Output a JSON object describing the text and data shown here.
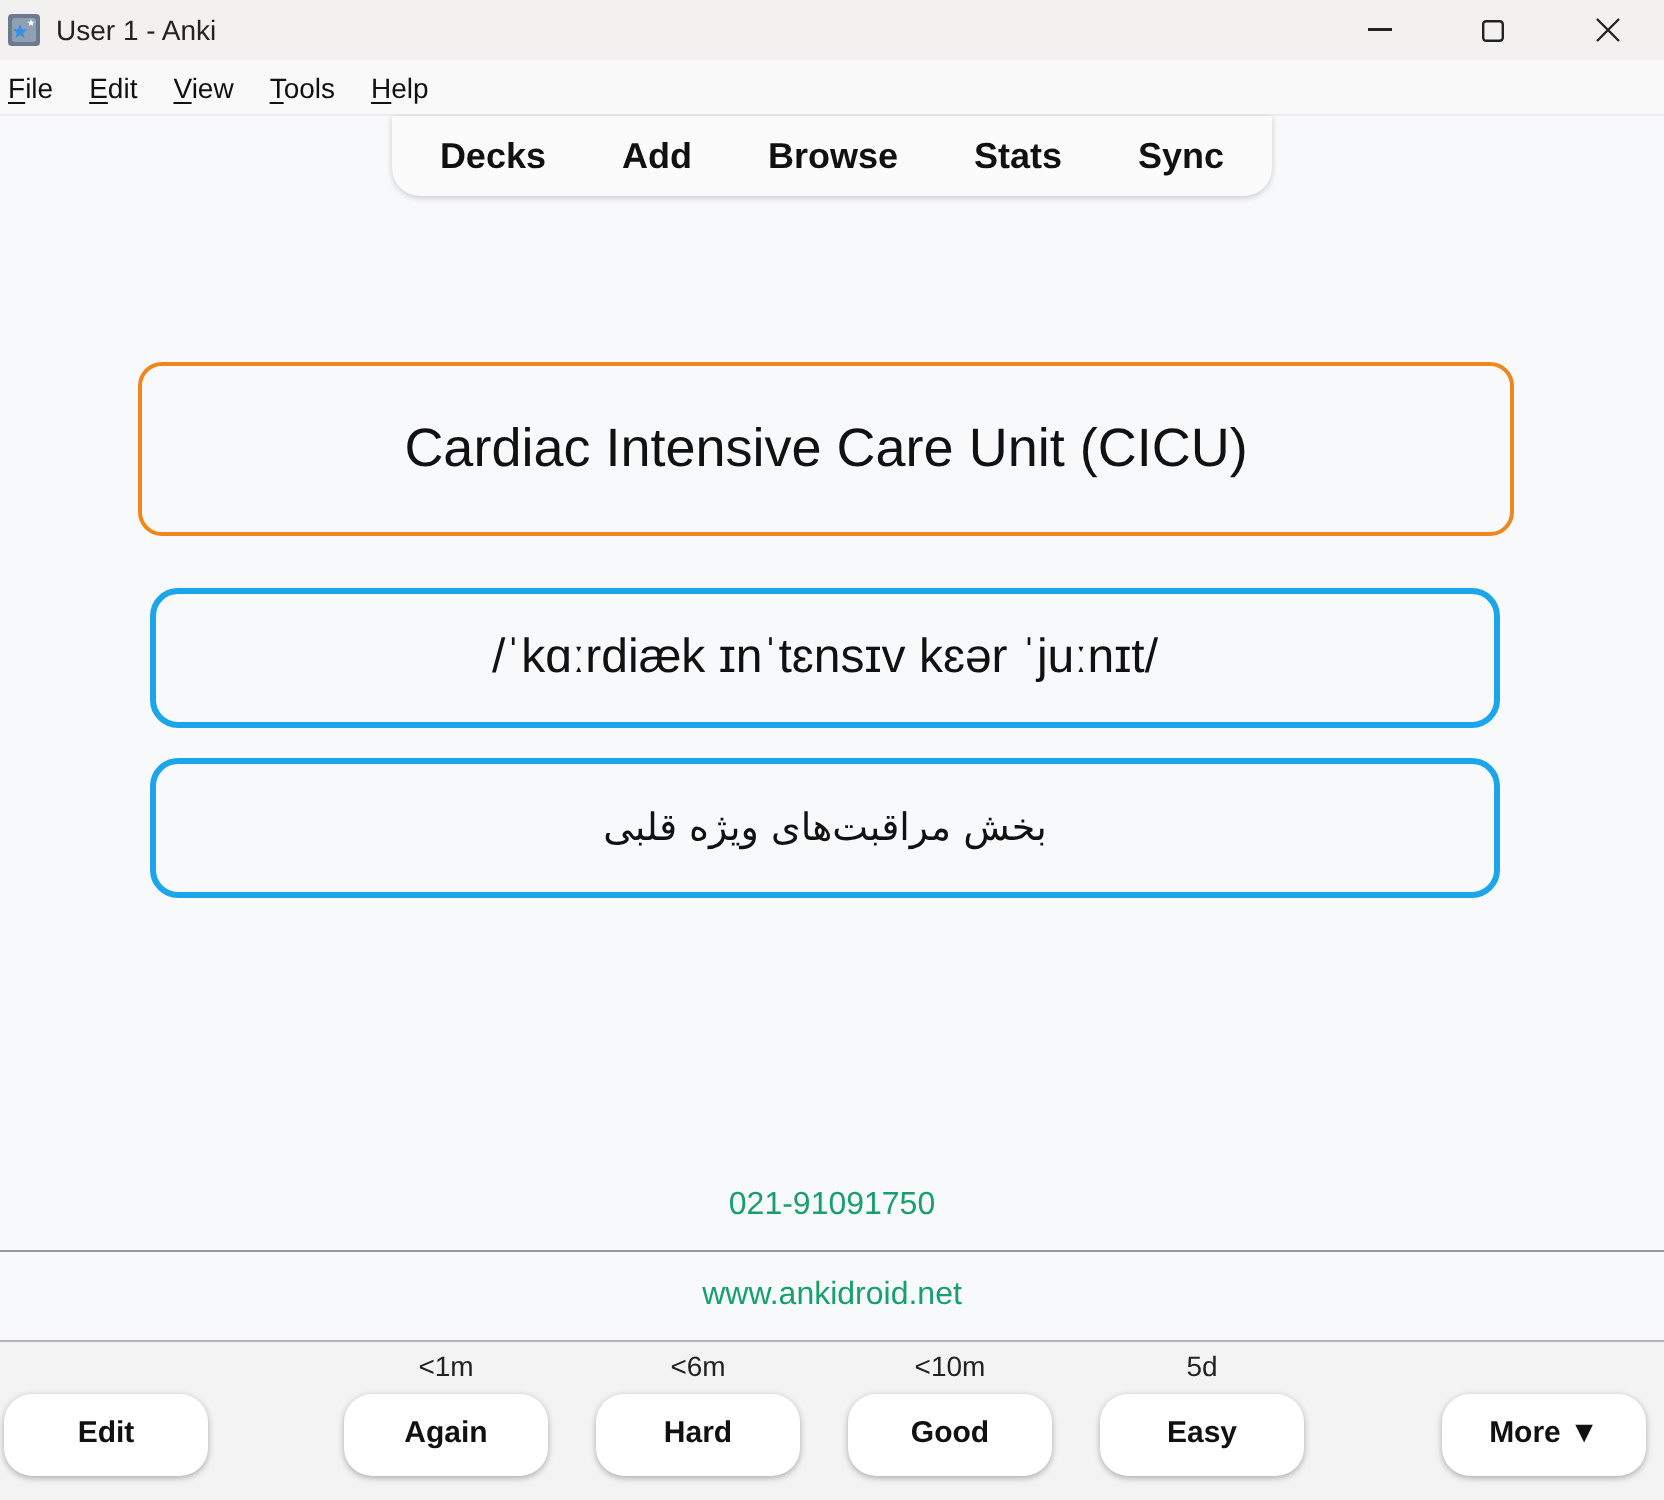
{
  "window": {
    "title": "User 1 - Anki"
  },
  "menu": [
    "File",
    "Edit",
    "View",
    "Tools",
    "Help"
  ],
  "toolbar": [
    "Decks",
    "Add",
    "Browse",
    "Stats",
    "Sync"
  ],
  "card": {
    "fields": [
      {
        "kind": "term",
        "text": "Cardiac Intensive Care Unit (CICU)"
      },
      {
        "kind": "pronunciation",
        "text": "/ˈkɑːrdiæk ɪnˈtɛnsɪv kɛər ˈjuːnɪt/"
      },
      {
        "kind": "translation",
        "text": "بخش مراقبت‌های ویژه قلبی"
      }
    ],
    "phone": "021-91091750",
    "website": "www.ankidroid.net"
  },
  "answer_bar": {
    "edit": "Edit",
    "buttons": [
      {
        "label": "Again",
        "interval": "<1m"
      },
      {
        "label": "Hard",
        "interval": "<6m"
      },
      {
        "label": "Good",
        "interval": "<10m"
      },
      {
        "label": "Easy",
        "interval": "5d"
      }
    ],
    "more": "More ▼"
  }
}
